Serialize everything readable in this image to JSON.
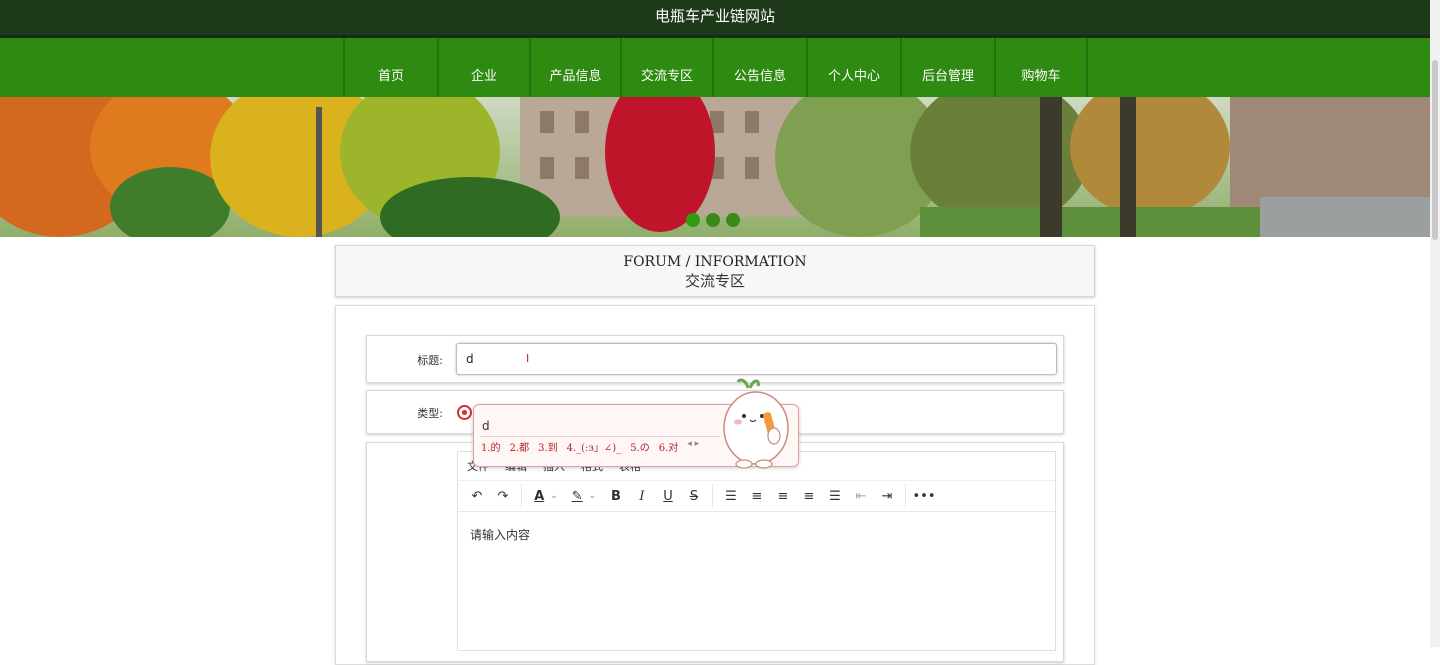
{
  "site": {
    "title": "电瓶车产业链网站"
  },
  "nav": {
    "items": [
      "首页",
      "企业",
      "产品信息",
      "交流专区",
      "公告信息",
      "个人中心",
      "后台管理",
      "购物车"
    ]
  },
  "section": {
    "title_en": "FORUM / INFORMATION",
    "title_cn": "交流专区"
  },
  "form": {
    "title_label": "标题:",
    "title_value": "d",
    "cursor_mark": "I",
    "type_label": "类型:"
  },
  "ime": {
    "input": "d",
    "candidates": [
      "1.的",
      "2.都",
      "3.到",
      "4._(:з」∠)_",
      "5.の",
      "6.对"
    ],
    "pager": "◂ ▸"
  },
  "editor": {
    "menus": [
      "文件",
      "编辑",
      "插入",
      "格式",
      "表格"
    ],
    "placeholder": "请输入内容",
    "toolbar_icons": [
      "undo-icon",
      "redo-icon",
      "font-color-icon",
      "highlight-icon",
      "bold-icon",
      "italic-icon",
      "underline-icon",
      "strikethrough-icon",
      "line-height-icon",
      "align-left-icon",
      "align-center-icon",
      "align-right-icon",
      "justify-icon",
      "outdent-icon",
      "indent-icon",
      "more-icon"
    ]
  },
  "colors": {
    "header": "#1f3a1a",
    "nav": "#2f8a12",
    "radio": "#d32f2f"
  }
}
